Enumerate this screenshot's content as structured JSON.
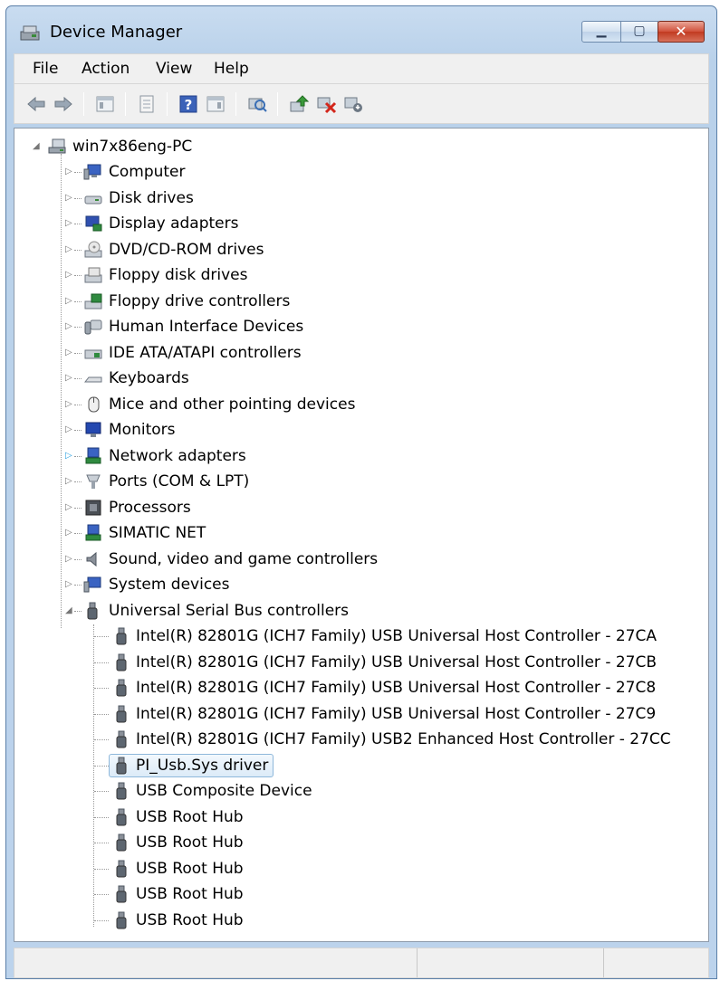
{
  "window": {
    "title": "Device Manager",
    "title_icon": "device-manager-icon"
  },
  "caption_buttons": {
    "minimize": "minimize",
    "maximize": "maximize",
    "close": "close"
  },
  "menu": [
    {
      "label": "File"
    },
    {
      "label": "Action"
    },
    {
      "label": "View"
    },
    {
      "label": "Help"
    }
  ],
  "toolbar": [
    {
      "icon": "back-arrow-icon"
    },
    {
      "icon": "forward-arrow-icon"
    },
    {
      "icon": "show-hide-tree-icon"
    },
    {
      "icon": "properties-icon"
    },
    {
      "icon": "help-icon"
    },
    {
      "icon": "show-hide-action-pane-icon"
    },
    {
      "icon": "scan-hardware-icon"
    },
    {
      "icon": "update-driver-icon"
    },
    {
      "icon": "uninstall-device-icon"
    },
    {
      "icon": "disable-device-icon"
    }
  ],
  "tree": {
    "root": {
      "label": "win7x86eng-PC",
      "icon": "computer-network-icon",
      "expanded": true
    },
    "categories": [
      {
        "label": "Computer",
        "icon": "computer-icon"
      },
      {
        "label": "Disk drives",
        "icon": "disk-drive-icon"
      },
      {
        "label": "Display adapters",
        "icon": "display-adapter-icon"
      },
      {
        "label": "DVD/CD-ROM drives",
        "icon": "dvd-drive-icon"
      },
      {
        "label": "Floppy disk drives",
        "icon": "floppy-disk-icon"
      },
      {
        "label": "Floppy drive controllers",
        "icon": "floppy-controller-icon"
      },
      {
        "label": "Human Interface Devices",
        "icon": "hid-icon"
      },
      {
        "label": "IDE ATA/ATAPI controllers",
        "icon": "ide-controller-icon"
      },
      {
        "label": "Keyboards",
        "icon": "keyboard-icon"
      },
      {
        "label": "Mice and other pointing devices",
        "icon": "mouse-icon"
      },
      {
        "label": "Monitors",
        "icon": "monitor-icon"
      },
      {
        "label": "Network adapters",
        "icon": "network-adapter-icon"
      },
      {
        "label": "Ports (COM & LPT)",
        "icon": "port-icon"
      },
      {
        "label": "Processors",
        "icon": "processor-icon"
      },
      {
        "label": "SIMATIC NET",
        "icon": "simatic-net-icon"
      },
      {
        "label": "Sound, video and game controllers",
        "icon": "speaker-icon"
      },
      {
        "label": "System devices",
        "icon": "system-devices-icon"
      },
      {
        "label": "Universal Serial Bus controllers",
        "icon": "usb-icon",
        "expanded": true
      }
    ],
    "usb_children": [
      {
        "label": "Intel(R) 82801G (ICH7 Family) USB Universal Host Controller - 27CA"
      },
      {
        "label": "Intel(R) 82801G (ICH7 Family) USB Universal Host Controller - 27CB"
      },
      {
        "label": "Intel(R) 82801G (ICH7 Family) USB Universal Host Controller - 27C8"
      },
      {
        "label": "Intel(R) 82801G (ICH7 Family) USB Universal Host Controller - 27C9"
      },
      {
        "label": "Intel(R) 82801G (ICH7 Family) USB2 Enhanced Host Controller - 27CC"
      },
      {
        "label": "PI_Usb.Sys driver",
        "selected": true
      },
      {
        "label": "USB Composite Device"
      },
      {
        "label": "USB Root Hub"
      },
      {
        "label": "USB Root Hub"
      },
      {
        "label": "USB Root Hub"
      },
      {
        "label": "USB Root Hub"
      },
      {
        "label": "USB Root Hub"
      }
    ]
  },
  "colors": {
    "selection_border": "#8fb8db",
    "titlebar": "#c9dcf0",
    "close_button": "#c23a20"
  }
}
